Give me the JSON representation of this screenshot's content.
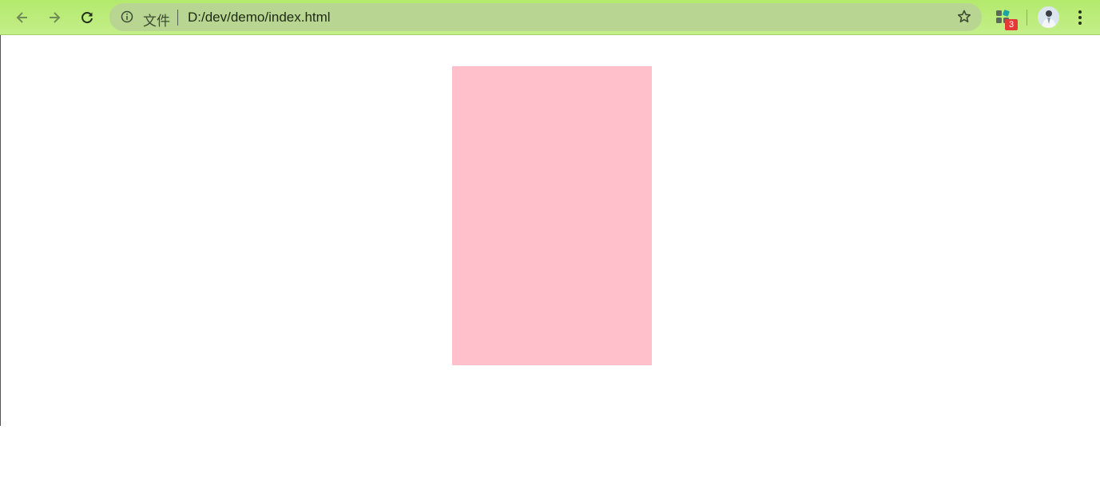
{
  "browser": {
    "scheme_label": "文件",
    "url": "D:/dev/demo/index.html",
    "toolbar_color": "#b3ea6c",
    "extension_badge": "3",
    "icons": {
      "back": "arrow-left-icon",
      "forward": "arrow-right-icon",
      "reload": "reload-icon",
      "info": "info-icon",
      "bookmark": "star-icon",
      "extensions": "extensions-icon",
      "profile": "avatar",
      "menu": "kebab-menu-icon"
    }
  },
  "page": {
    "box_color": "#ffc0cb"
  }
}
